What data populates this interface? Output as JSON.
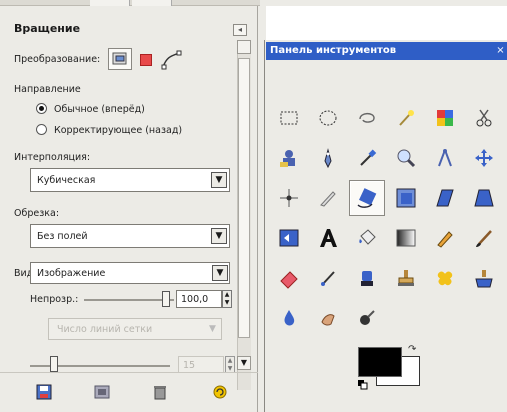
{
  "dock": {
    "title": "Вращение",
    "transform_label": "Преобразование:",
    "direction_label": "Направление",
    "radio_normal": "Обычное (вперёд)",
    "radio_corrective": "Корректирующее (назад)",
    "interpolation_label": "Интерполяция:",
    "interpolation_value": "Кубическая",
    "clipping_label": "Обрезка:",
    "clipping_value": "Без полей",
    "preview_label": "Вид:",
    "preview_value": "Изображение",
    "opacity_label": "Непрозр.:",
    "opacity_value": "100,0",
    "opacity_level": 1.0,
    "grid_combo_value": "Число линий сетки",
    "grid_lines_value": "15"
  },
  "toolbox": {
    "title": "Панель инструментов",
    "close_symbol": "×"
  },
  "colors": {
    "foreground": "#000000",
    "background": "#ffffff",
    "title_bar": "#2f5ec6"
  }
}
